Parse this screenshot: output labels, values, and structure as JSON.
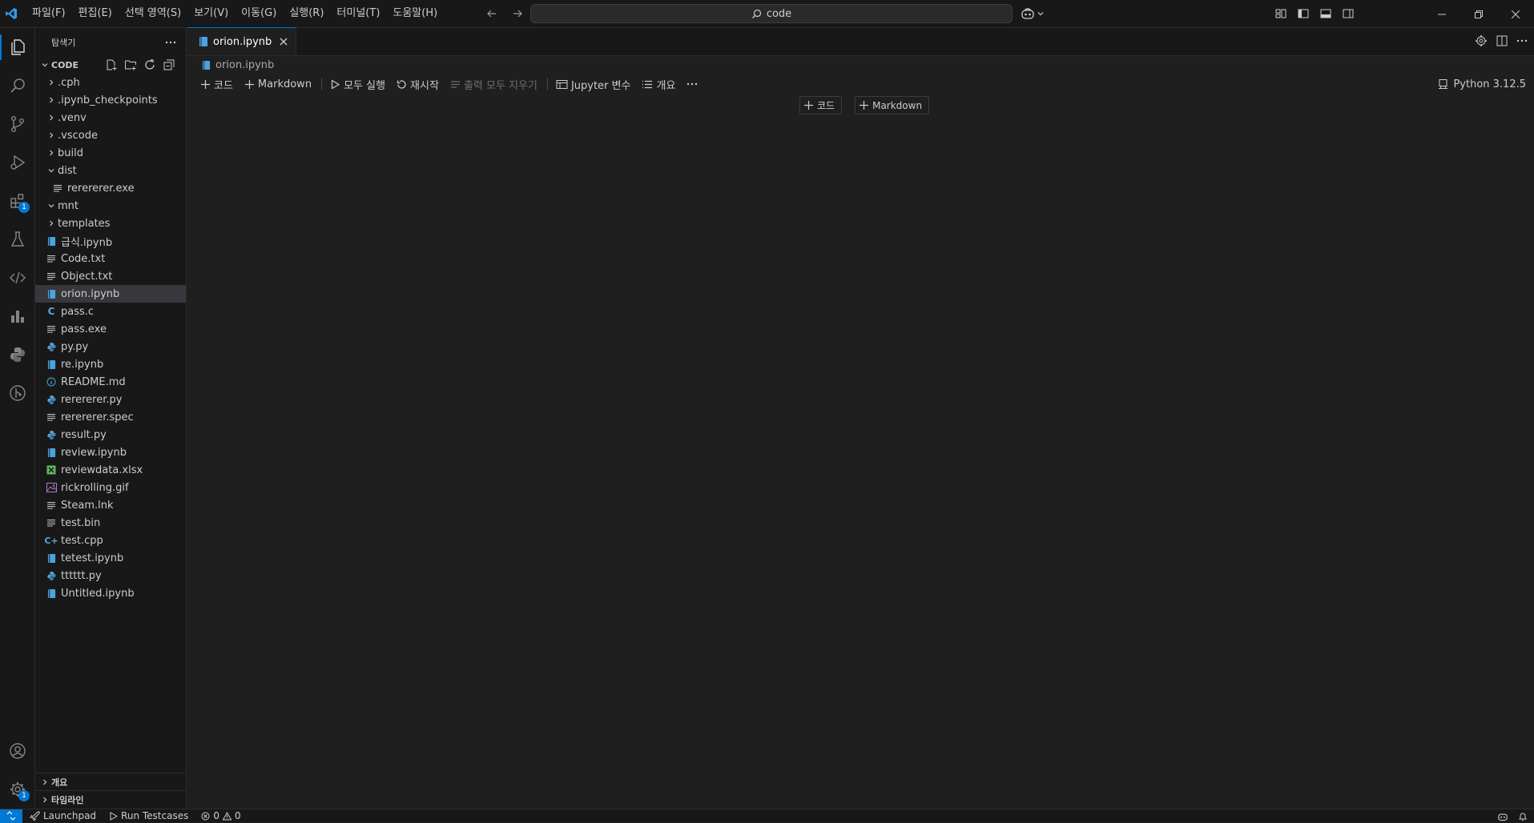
{
  "menubar": [
    "파일(F)",
    "편집(E)",
    "선택 영역(S)",
    "보기(V)",
    "이동(G)",
    "실행(R)",
    "터미널(T)",
    "도움말(H)"
  ],
  "search": {
    "text": "code"
  },
  "activity_badges": {
    "extensions": "1",
    "manage": "1"
  },
  "sidebar": {
    "title": "탐색기",
    "section": "CODE",
    "files": [
      {
        "name": ".cph",
        "kind": "folder",
        "open": false,
        "depth": 0
      },
      {
        "name": ".ipynb_checkpoints",
        "kind": "folder",
        "open": false,
        "depth": 0
      },
      {
        "name": ".venv",
        "kind": "folder",
        "open": false,
        "depth": 0
      },
      {
        "name": ".vscode",
        "kind": "folder",
        "open": false,
        "depth": 0
      },
      {
        "name": "build",
        "kind": "folder",
        "open": false,
        "depth": 0
      },
      {
        "name": "dist",
        "kind": "folder",
        "open": true,
        "depth": 0
      },
      {
        "name": "rerererer.exe",
        "kind": "lines",
        "depth": 1
      },
      {
        "name": "mnt",
        "kind": "folder",
        "open": true,
        "depth": 0
      },
      {
        "name": "templates",
        "kind": "folder",
        "open": false,
        "depth": 0
      },
      {
        "name": "급식.ipynb",
        "kind": "notebook",
        "depth": 0
      },
      {
        "name": "Code.txt",
        "kind": "lines",
        "depth": 0
      },
      {
        "name": "Object.txt",
        "kind": "lines",
        "depth": 0
      },
      {
        "name": "orion.ipynb",
        "kind": "notebook",
        "depth": 0,
        "selected": true
      },
      {
        "name": "pass.c",
        "kind": "c",
        "depth": 0
      },
      {
        "name": "pass.exe",
        "kind": "lines",
        "depth": 0
      },
      {
        "name": "py.py",
        "kind": "python",
        "depth": 0
      },
      {
        "name": "re.ipynb",
        "kind": "notebook",
        "depth": 0
      },
      {
        "name": "README.md",
        "kind": "info",
        "depth": 0
      },
      {
        "name": "rerererer.py",
        "kind": "python",
        "depth": 0
      },
      {
        "name": "rerererer.spec",
        "kind": "lines",
        "depth": 0
      },
      {
        "name": "result.py",
        "kind": "python",
        "depth": 0
      },
      {
        "name": "review.ipynb",
        "kind": "notebook",
        "depth": 0
      },
      {
        "name": "reviewdata.xlsx",
        "kind": "excel",
        "depth": 0
      },
      {
        "name": "rickrolling.gif",
        "kind": "image",
        "depth": 0
      },
      {
        "name": "Steam.lnk",
        "kind": "lines",
        "depth": 0
      },
      {
        "name": "test.bin",
        "kind": "lines",
        "depth": 0
      },
      {
        "name": "test.cpp",
        "kind": "cpp",
        "depth": 0
      },
      {
        "name": "tetest.ipynb",
        "kind": "notebook",
        "depth": 0
      },
      {
        "name": "tttttt.py",
        "kind": "python",
        "depth": 0
      },
      {
        "name": "Untitled.ipynb",
        "kind": "notebook",
        "depth": 0
      }
    ],
    "outline": "개요",
    "timeline": "타임라인"
  },
  "editor": {
    "tab": "orion.ipynb",
    "breadcrumb": "orion.ipynb",
    "toolbar": {
      "code": "코드",
      "markdown": "Markdown",
      "run_all": "모두 실행",
      "restart": "재시작",
      "clear_outputs": "출력 모두 지우기",
      "variables": "Jupyter 변수",
      "outline": "개요"
    },
    "kernel": "Python 3.12.5",
    "insert": {
      "code": "코드",
      "markdown": "Markdown"
    }
  },
  "statusbar": {
    "launchpad": "Launchpad",
    "run_testcases": "Run Testcases",
    "errors": "0",
    "warnings": "0"
  },
  "colors": {
    "accent": "#0078d4",
    "notebook_icon": "#4aa3df",
    "python_icon": "#5aa7d8",
    "excel_icon": "#5cb85c",
    "image_icon": "#b07cc6"
  }
}
